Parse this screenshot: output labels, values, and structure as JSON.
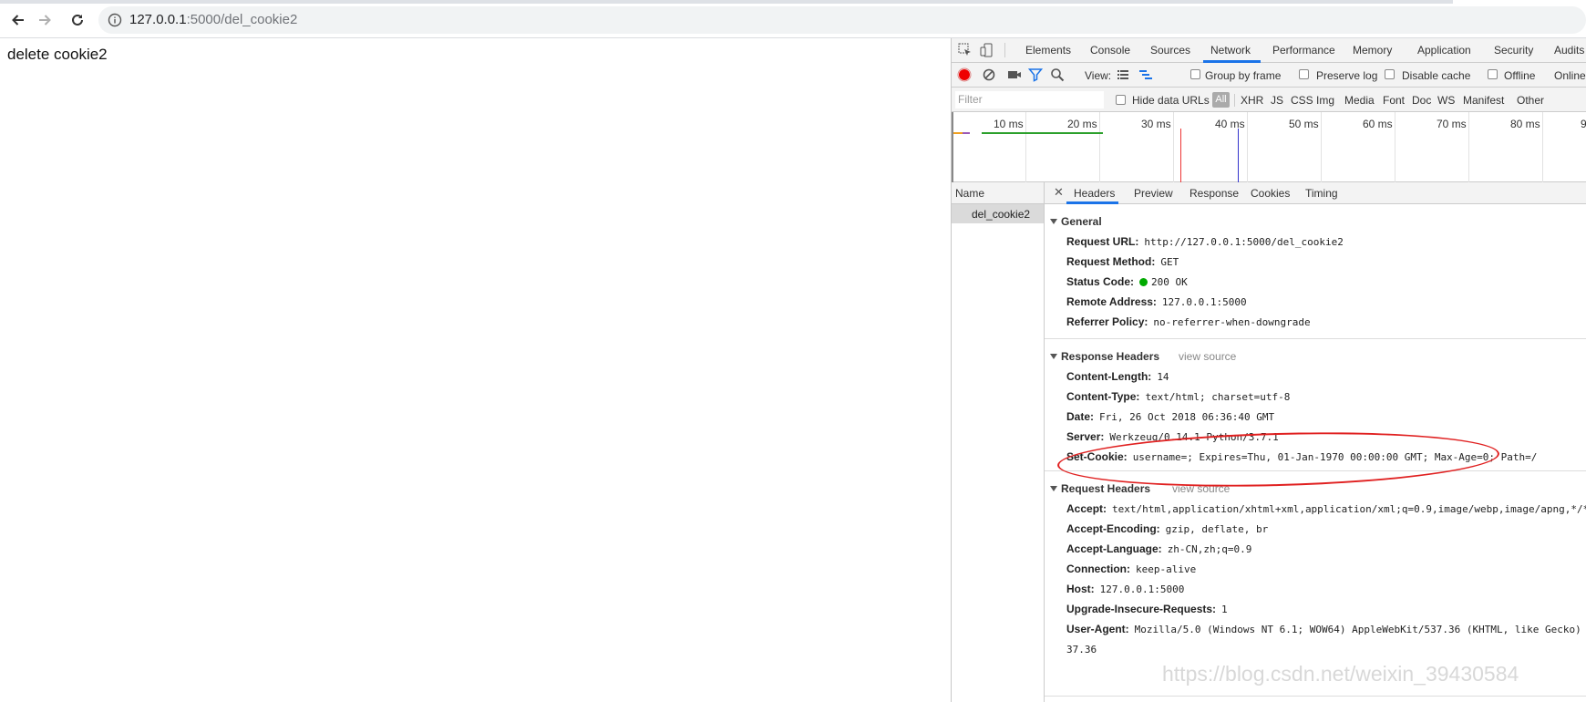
{
  "browser": {
    "url_host": "127.0.0.1",
    "url_rest": ":5000/del_cookie2"
  },
  "page": {
    "text": "delete cookie2"
  },
  "devtools": {
    "tabs": [
      "Elements",
      "Console",
      "Sources",
      "Network",
      "Performance",
      "Memory",
      "Application",
      "Security",
      "Audits"
    ],
    "active_tab": "Network",
    "toolbar": {
      "view_label": "View:",
      "group_by_frame": "Group by frame",
      "preserve_log": "Preserve log",
      "disable_cache": "Disable cache",
      "offline": "Offline",
      "online": "Online"
    },
    "filter": {
      "placeholder": "Filter",
      "hide_data_urls": "Hide data URLs",
      "all": "All",
      "types": [
        "XHR",
        "JS",
        "CSS",
        "Img",
        "Media",
        "Font",
        "Doc",
        "WS",
        "Manifest",
        "Other"
      ]
    },
    "timeline": {
      "labels": [
        "10 ms",
        "20 ms",
        "30 ms",
        "40 ms",
        "50 ms",
        "60 ms",
        "70 ms",
        "80 ms",
        "9"
      ]
    },
    "name_header": "Name",
    "request_name": "del_cookie2",
    "detail_tabs": [
      "Headers",
      "Preview",
      "Response",
      "Cookies",
      "Timing"
    ],
    "active_detail_tab": "Headers",
    "general": {
      "title": "General",
      "rows": [
        {
          "k": "Request URL:",
          "v": "http://127.0.0.1:5000/del_cookie2"
        },
        {
          "k": "Request Method:",
          "v": "GET"
        },
        {
          "k": "Status Code:",
          "v": "200 OK"
        },
        {
          "k": "Remote Address:",
          "v": "127.0.0.1:5000"
        },
        {
          "k": "Referrer Policy:",
          "v": "no-referrer-when-downgrade"
        }
      ]
    },
    "response_headers": {
      "title": "Response Headers",
      "view_source": "view source",
      "rows": [
        {
          "k": "Content-Length:",
          "v": "14"
        },
        {
          "k": "Content-Type:",
          "v": "text/html; charset=utf-8"
        },
        {
          "k": "Date:",
          "v": "Fri, 26 Oct 2018 06:36:40 GMT"
        },
        {
          "k": "Server:",
          "v": "Werkzeug/0.14.1 Python/3.7.1"
        },
        {
          "k": "Set-Cookie:",
          "v": "username=; Expires=Thu, 01-Jan-1970 00:00:00 GMT; Max-Age=0; Path=/"
        }
      ]
    },
    "request_headers": {
      "title": "Request Headers",
      "view_source": "view source",
      "rows": [
        {
          "k": "Accept:",
          "v": "text/html,application/xhtml+xml,application/xml;q=0.9,image/webp,image/apng,*/*"
        },
        {
          "k": "Accept-Encoding:",
          "v": "gzip, deflate, br"
        },
        {
          "k": "Accept-Language:",
          "v": "zh-CN,zh;q=0.9"
        },
        {
          "k": "Connection:",
          "v": "keep-alive"
        },
        {
          "k": "Host:",
          "v": "127.0.0.1:5000"
        },
        {
          "k": "Upgrade-Insecure-Requests:",
          "v": "1"
        },
        {
          "k": "User-Agent:",
          "v": "Mozilla/5.0 (Windows NT 6.1; WOW64) AppleWebKit/537.36 (KHTML, like Gecko) "
        }
      ],
      "ua_wrap": "37.36"
    }
  },
  "watermark": "https://blog.csdn.net/weixin_39430584"
}
